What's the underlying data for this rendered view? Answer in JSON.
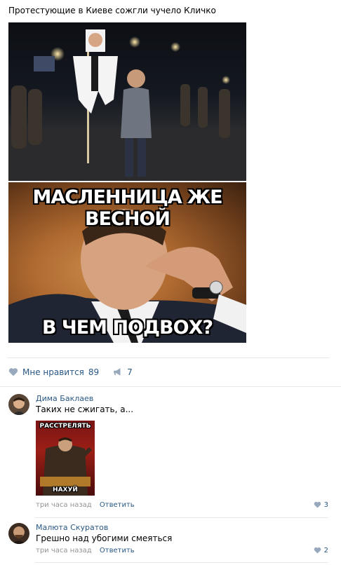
{
  "post": {
    "text": "Протестующие в Киеве сожгли чучело Кличко",
    "photo1": {
      "icon": "effigy-protest-photo"
    },
    "photo2": {
      "icon": "klitschko-meme-photo",
      "top_caption": "МАСЛЕННИЦА ЖЕ ВЕСНОЙ",
      "bottom_caption": "В ЧЕМ ПОДВОХ?"
    }
  },
  "actions": {
    "like_label": "Мне нравится",
    "like_count": "89",
    "share_count": "7",
    "like_icon": "heart-icon",
    "share_icon": "megaphone-icon"
  },
  "comments": [
    {
      "author": "Дима Баклаев",
      "text": "Таких не сжигать, а...",
      "attachment": {
        "top": "РАССТРЕЛЯТЬ",
        "bottom": "НАХУЙ"
      },
      "time": "три часа назад",
      "reply": "Ответить",
      "likes": "3"
    },
    {
      "author": "Малюта Скуратов",
      "text": "Грешно над убогими смеяться",
      "time": "три часа назад",
      "reply": "Ответить",
      "likes": "2"
    }
  ],
  "colors": {
    "link": "#2a5885",
    "meta": "#939393",
    "divider": "#e7e8ec"
  }
}
